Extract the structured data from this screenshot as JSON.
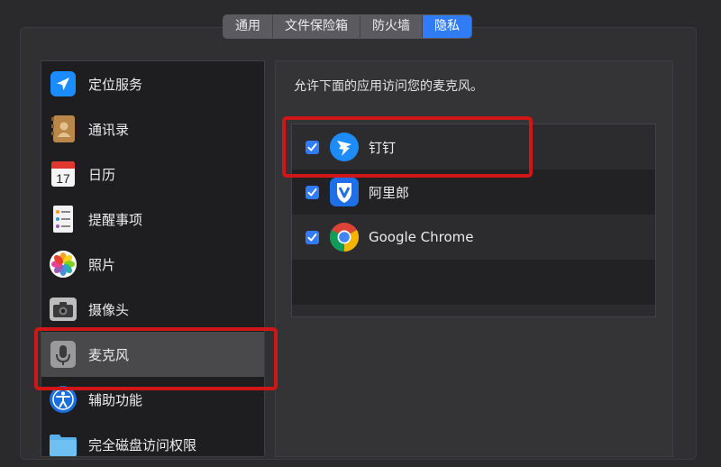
{
  "tabs": [
    {
      "label": "通用",
      "active": false
    },
    {
      "label": "文件保险箱",
      "active": false
    },
    {
      "label": "防火墙",
      "active": false
    },
    {
      "label": "隐私",
      "active": true
    }
  ],
  "sidebar": {
    "items": [
      {
        "label": "定位服务",
        "icon": "location-arrow-icon"
      },
      {
        "label": "通讯录",
        "icon": "contacts-book-icon"
      },
      {
        "label": "日历",
        "icon": "calendar-icon",
        "icon_text": "17"
      },
      {
        "label": "提醒事项",
        "icon": "reminders-list-icon"
      },
      {
        "label": "照片",
        "icon": "photos-flower-icon"
      },
      {
        "label": "摄像头",
        "icon": "camera-icon"
      },
      {
        "label": "麦克风",
        "icon": "microphone-icon",
        "selected": true
      },
      {
        "label": "辅助功能",
        "icon": "accessibility-icon"
      },
      {
        "label": "完全磁盘访问权限",
        "icon": "folder-icon"
      }
    ]
  },
  "content": {
    "description": "允许下面的应用访问您的麦克风。",
    "apps": [
      {
        "name": "钉钉",
        "checked": true,
        "icon": "dingtalk-icon"
      },
      {
        "name": "阿里郎",
        "checked": true,
        "icon": "alilang-shield-icon"
      },
      {
        "name": "Google Chrome",
        "checked": true,
        "icon": "chrome-icon"
      }
    ]
  },
  "colors": {
    "accent": "#2f7cf6",
    "highlight": "#d01616",
    "sidebar_selected": "#49494c"
  }
}
